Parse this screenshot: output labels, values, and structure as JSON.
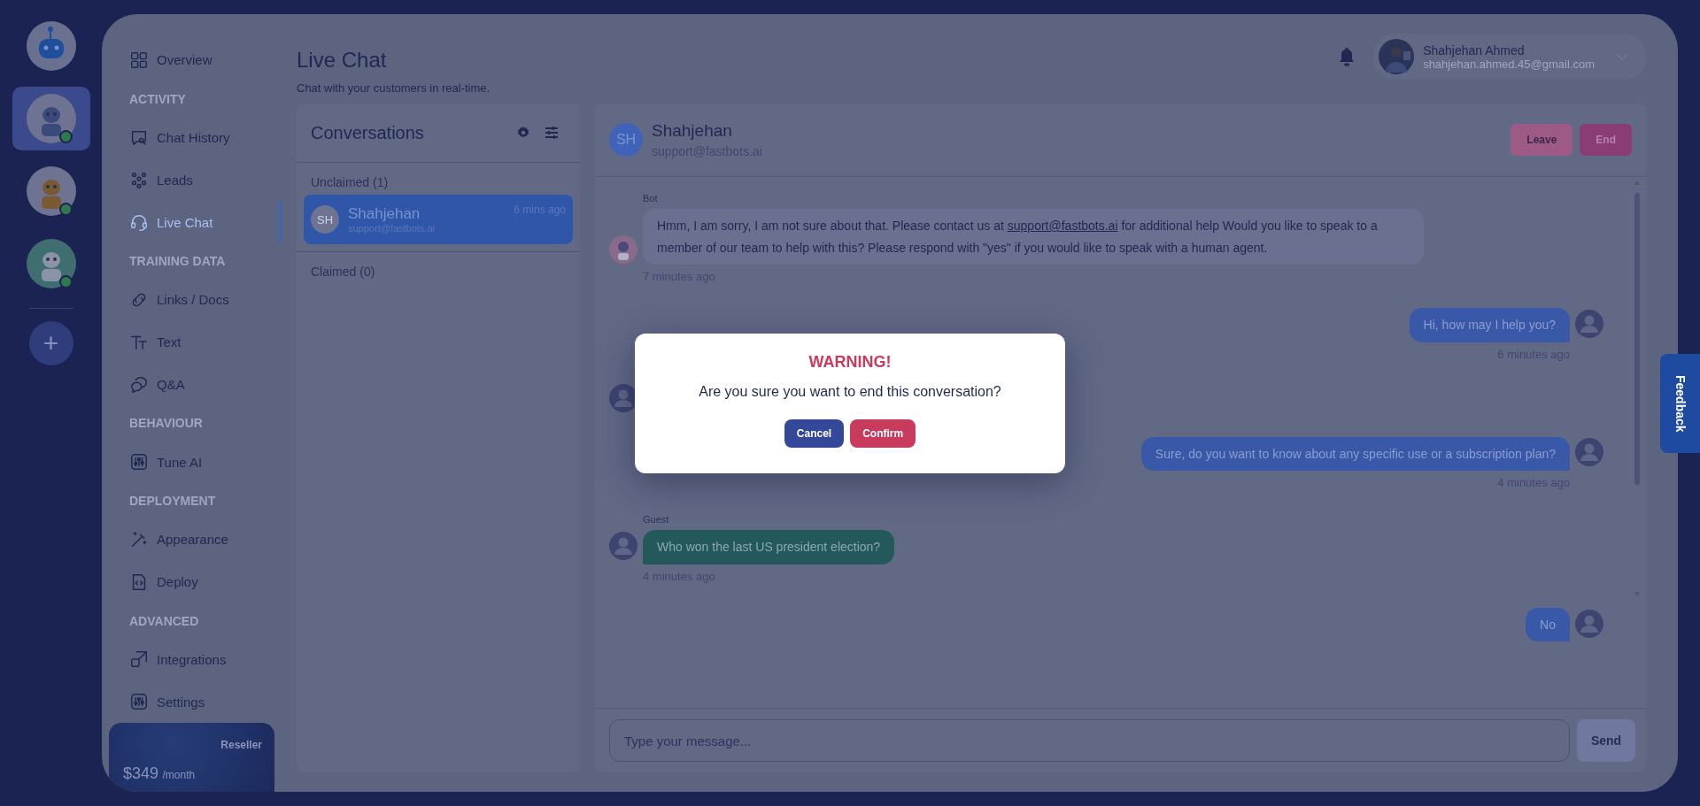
{
  "rail": {
    "bots": [
      {
        "selected": false,
        "online": false
      },
      {
        "selected": true,
        "online": true
      },
      {
        "selected": false,
        "online": true
      },
      {
        "selected": false,
        "online": true
      }
    ],
    "add_label": "+"
  },
  "nav": [
    {
      "kind": "item",
      "label": "Overview",
      "selected": false
    },
    {
      "kind": "heading",
      "label": "ACTIVITY"
    },
    {
      "kind": "item",
      "label": "Chat History",
      "selected": false
    },
    {
      "kind": "item",
      "label": "Leads",
      "selected": false
    },
    {
      "kind": "item",
      "label": "Live Chat",
      "selected": true
    },
    {
      "kind": "heading",
      "label": "TRAINING DATA"
    },
    {
      "kind": "item",
      "label": "Links / Docs",
      "selected": false
    },
    {
      "kind": "item",
      "label": "Text",
      "selected": false
    },
    {
      "kind": "item",
      "label": "Q&A",
      "selected": false
    },
    {
      "kind": "heading",
      "label": "BEHAVIOUR"
    },
    {
      "kind": "item",
      "label": "Tune AI",
      "selected": false
    },
    {
      "kind": "heading",
      "label": "DEPLOYMENT"
    },
    {
      "kind": "item",
      "label": "Appearance",
      "selected": false
    },
    {
      "kind": "item",
      "label": "Deploy",
      "selected": false
    },
    {
      "kind": "heading",
      "label": "ADVANCED"
    },
    {
      "kind": "item",
      "label": "Integrations",
      "selected": false
    },
    {
      "kind": "item",
      "label": "Settings",
      "selected": false
    }
  ],
  "plan": {
    "name": "Reseller",
    "price": "$349",
    "period": "/month"
  },
  "header": {
    "title": "Live Chat",
    "subtitle": "Chat with your customers in real-time."
  },
  "user": {
    "name": "Shahjehan Ahmed",
    "email": "shahjehan.ahmed.45@gmail.com"
  },
  "conversations": {
    "title": "Conversations",
    "groups": [
      {
        "label": "Unclaimed (1)",
        "items": [
          {
            "initials": "SH",
            "name": "Shahjehan",
            "email": "support@fastbots.ai",
            "time": "6 mins ago",
            "selected": true
          }
        ]
      },
      {
        "label": "Claimed (0)"
      }
    ]
  },
  "chat": {
    "initials": "SH",
    "name": "Shahjehan",
    "email": "support@fastbots.ai",
    "buttons": [
      {
        "kind": "leave",
        "label": "Leave"
      },
      {
        "kind": "end",
        "label": "End"
      }
    ],
    "messages": [
      {
        "kind": "bot",
        "sender": "Bot",
        "text_before": "Hmm, I am sorry, I am not sure about that. Please contact us at ",
        "link": "support@fastbots.ai",
        "text_after": " for additional help Would you like to speak to a member of our team to help with this? Please respond with \"yes\" if you would like to speak with a human agent.",
        "time": "7 minutes ago"
      },
      {
        "kind": "agent",
        "text": "Hi, how may I help you?",
        "time": "6 minutes ago"
      },
      {
        "kind": "hidden"
      },
      {
        "kind": "agent",
        "text": "Sure, do you want to know about any specific use or a subscription plan?",
        "time": "4 minutes ago"
      },
      {
        "kind": "guest",
        "sender": "Guest",
        "text": "Who won the last US president election?",
        "time": "4 minutes ago"
      },
      {
        "kind": "agent",
        "text": "No"
      }
    ],
    "input": {
      "placeholder": "Type your message..."
    },
    "send": "Send"
  },
  "feedback": "Feedback",
  "dialog": {
    "title": "WARNING!",
    "message": "Are you sure you want to end this conversation?",
    "buttons": [
      {
        "kind": "cancel",
        "label": "Cancel"
      },
      {
        "kind": "confirm",
        "label": "Confirm"
      }
    ]
  }
}
